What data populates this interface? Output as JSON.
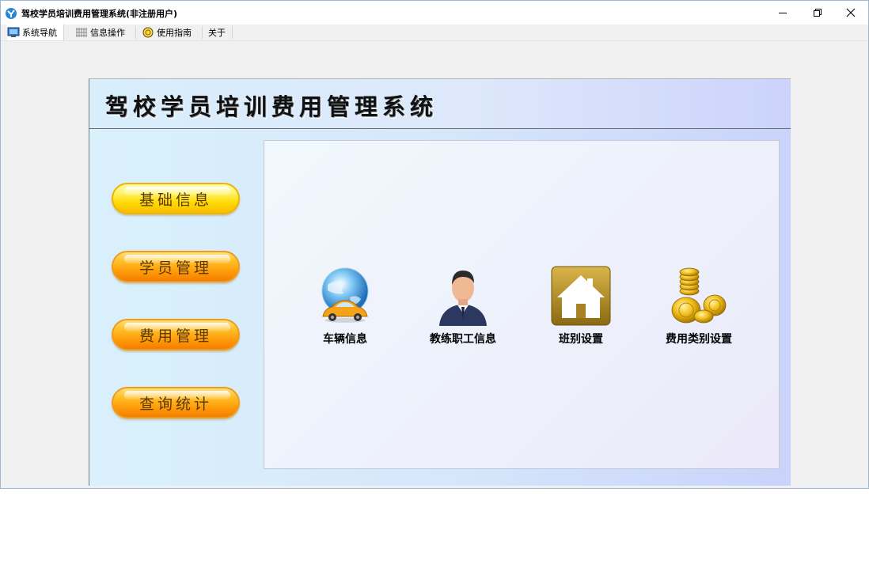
{
  "window": {
    "title": "驾校学员培训费用管理系统(非注册用户)"
  },
  "menubar": {
    "items": [
      {
        "label": "系统导航",
        "icon": "monitor-icon"
      },
      {
        "label": "信息操作",
        "icon": "grid-icon"
      },
      {
        "label": "使用指南",
        "icon": "help-icon"
      },
      {
        "label": "关于",
        "icon": ""
      }
    ]
  },
  "header": {
    "title": "驾校学员培训费用管理系统"
  },
  "nav": {
    "buttons": [
      {
        "label": "基础信息",
        "style": "yellow"
      },
      {
        "label": "学员管理",
        "style": "orange"
      },
      {
        "label": "费用管理",
        "style": "orange"
      },
      {
        "label": "查询统计",
        "style": "orange"
      }
    ]
  },
  "tiles": [
    {
      "label": "车辆信息",
      "icon": "car-globe-icon"
    },
    {
      "label": "教练职工信息",
      "icon": "staff-person-icon"
    },
    {
      "label": "班别设置",
      "icon": "house-icon"
    },
    {
      "label": "费用类别设置",
      "icon": "coins-icon"
    }
  ],
  "colors": {
    "nav_yellow": "#ffd900",
    "nav_orange": "#ff9e0a",
    "panel_bg": "#d6e7fb"
  }
}
